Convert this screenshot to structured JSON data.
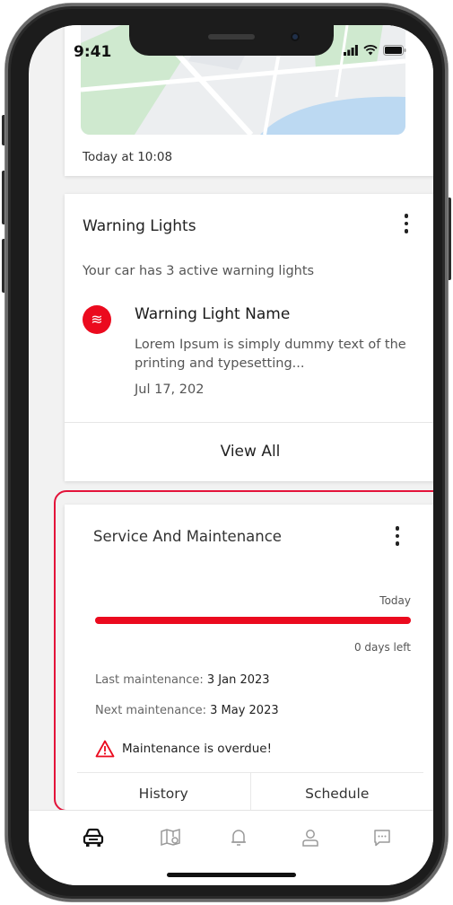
{
  "status_bar": {
    "time": "9:41",
    "signal_icon": "signal-icon",
    "wifi_icon": "wifi-icon",
    "battery_icon": "battery-icon"
  },
  "location_card": {
    "timestamp": "Today at 10:08",
    "map_icon": "map-preview"
  },
  "warning_card": {
    "title": "Warning Lights",
    "subtitle": "Your car has 3 active warning lights",
    "item": {
      "icon": "warning-light-icon",
      "icon_glyph": "≋",
      "name": "Warning Light Name",
      "description": "Lorem Ipsum is simply dummy text of the printing and typesetting...",
      "date": "Jul 17, 202"
    },
    "view_all_label": "View All",
    "menu_icon": "more-vertical-icon"
  },
  "service_card": {
    "title": "Service And Maintenance",
    "today_label": "Today",
    "progress_percent": 100,
    "days_left": "0 days left",
    "last_maintenance_label": "Last maintenance:",
    "last_maintenance_value": "3 Jan 2023",
    "next_maintenance_label": "Next maintenance:",
    "next_maintenance_value": "3 May 2023",
    "overdue_text": "Maintenance is overdue!",
    "history_label": "History",
    "schedule_label": "Schedule",
    "accent_color": "#eb0a1e"
  },
  "tab_bar": {
    "tabs": [
      {
        "icon": "car-icon",
        "active": true
      },
      {
        "icon": "map-icon",
        "active": false
      },
      {
        "icon": "bell-icon",
        "active": false
      },
      {
        "icon": "profile-icon",
        "active": false
      },
      {
        "icon": "chat-icon",
        "active": false
      }
    ]
  }
}
